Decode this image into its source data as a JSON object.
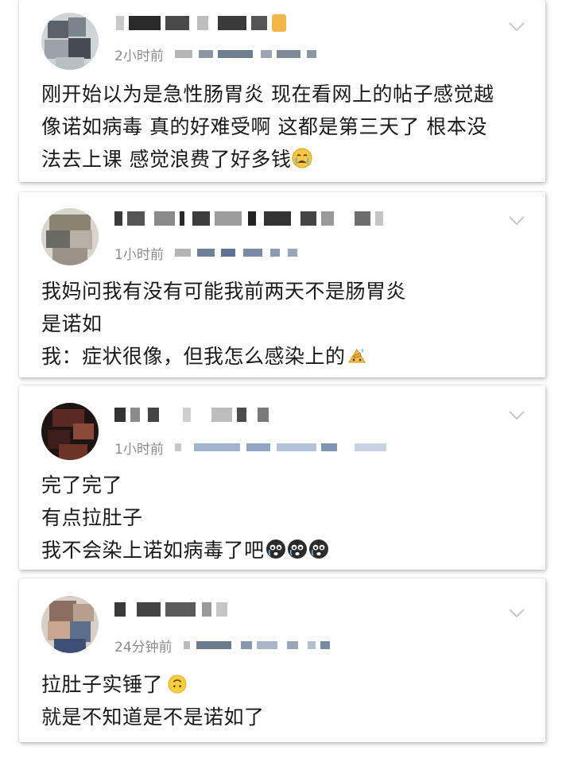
{
  "colors": {
    "text": "#1a1a1a",
    "meta_text": "#8c8c8c",
    "chevron": "#c8c8c8",
    "card_bg": "#ffffff"
  },
  "comments": [
    {
      "time": "2小时前",
      "lines": [
        "刚开始以为是急性肠胃炎 现在看网上的帖子感觉越",
        "像诺如病毒 真的好难受啊 这都是第三天了 根本没",
        "法去上课 感觉浪费了好多钱"
      ],
      "emoji": [
        "crying-face"
      ]
    },
    {
      "time": "1小时前",
      "lines": [
        "我妈问我有没有可能我前两天不是肠胃炎",
        "是诺如",
        "我：症状很像，但我怎么感染上的"
      ],
      "emoji": [
        "facepalm-sweat"
      ]
    },
    {
      "time": "1小时前",
      "lines": [
        "完了完了",
        "有点拉肚子",
        "我不会染上诺如病毒了吧"
      ],
      "emoji": [
        "crying-face-dark",
        "crying-face-dark",
        "crying-face-dark"
      ]
    },
    {
      "time": "24分钟前",
      "lines": [
        "拉肚子实锤了",
        "就是不知道是不是诺如了"
      ],
      "emoji": [
        "upside-down-face"
      ]
    }
  ]
}
